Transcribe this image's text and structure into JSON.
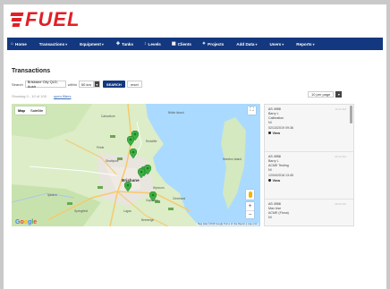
{
  "brand": {
    "name": "FUEL",
    "color": "#e21f26"
  },
  "nav": {
    "items": [
      {
        "label": "Home",
        "icon": "home-icon",
        "glyph": "⌂",
        "caret": false
      },
      {
        "label": "Transactions",
        "icon": "",
        "glyph": "",
        "caret": true
      },
      {
        "label": "Equipment",
        "icon": "",
        "glyph": "",
        "caret": true
      },
      {
        "label": "Tanks",
        "icon": "tank-icon",
        "glyph": "✚",
        "caret": false
      },
      {
        "label": "Levels",
        "icon": "level-icon",
        "glyph": "↕",
        "caret": false
      },
      {
        "label": "Clients",
        "icon": "clients-icon",
        "glyph": "▦",
        "caret": false
      },
      {
        "label": "Projects",
        "icon": "projects-icon",
        "glyph": "✦",
        "caret": false
      },
      {
        "label": "Add Data",
        "icon": "",
        "glyph": "",
        "caret": true
      },
      {
        "label": "Users",
        "icon": "",
        "glyph": "",
        "caret": true
      },
      {
        "label": "Reports",
        "icon": "",
        "glyph": "",
        "caret": true
      }
    ],
    "bg_color": "#14387f"
  },
  "page": {
    "title": "Transactions"
  },
  "search": {
    "label": "Search",
    "value": "Brisbane City QLD, Austr",
    "within_label": "within",
    "radius": "50 km",
    "search_button": "SEARCH",
    "reset_button": "reset"
  },
  "filters": {
    "showing": "Showing 0 - 10 of 100",
    "link": "open filters"
  },
  "pagination": {
    "per_page": "10 per page"
  },
  "map": {
    "type_map": "Map",
    "type_satellite": "Satellite",
    "city_label": "Brisbane",
    "google_label": "Google",
    "footer": "Map data ©2019 Google   Terms of Use   Report a map error",
    "places": [
      "Caboolture",
      "Redcliffe",
      "Bribie Island",
      "Petrie",
      "Strathpine",
      "Ipswich",
      "Logan",
      "Wynnum",
      "Capalaba",
      "Cleveland",
      "Beenleigh",
      "Springfield",
      "Moreton Island"
    ]
  },
  "list": {
    "cards": [
      {
        "code": "AS 4958",
        "tag": "10:41 AM",
        "lines": [
          "Barry L",
          "Calibration",
          "NI",
          "02/13/2019 09:36"
        ],
        "view": "View"
      },
      {
        "code": "AS 4958",
        "tag": "09:12 AM",
        "lines": [
          "Barry L",
          "ACME Testing",
          "NI",
          "12/04/2018 13:45"
        ],
        "view": "View"
      },
      {
        "code": "AS 4958",
        "tag": "08:03 AM",
        "lines": [
          "Max Use",
          "ACME (Fiona)",
          "NI",
          ""
        ],
        "view": ""
      }
    ]
  }
}
